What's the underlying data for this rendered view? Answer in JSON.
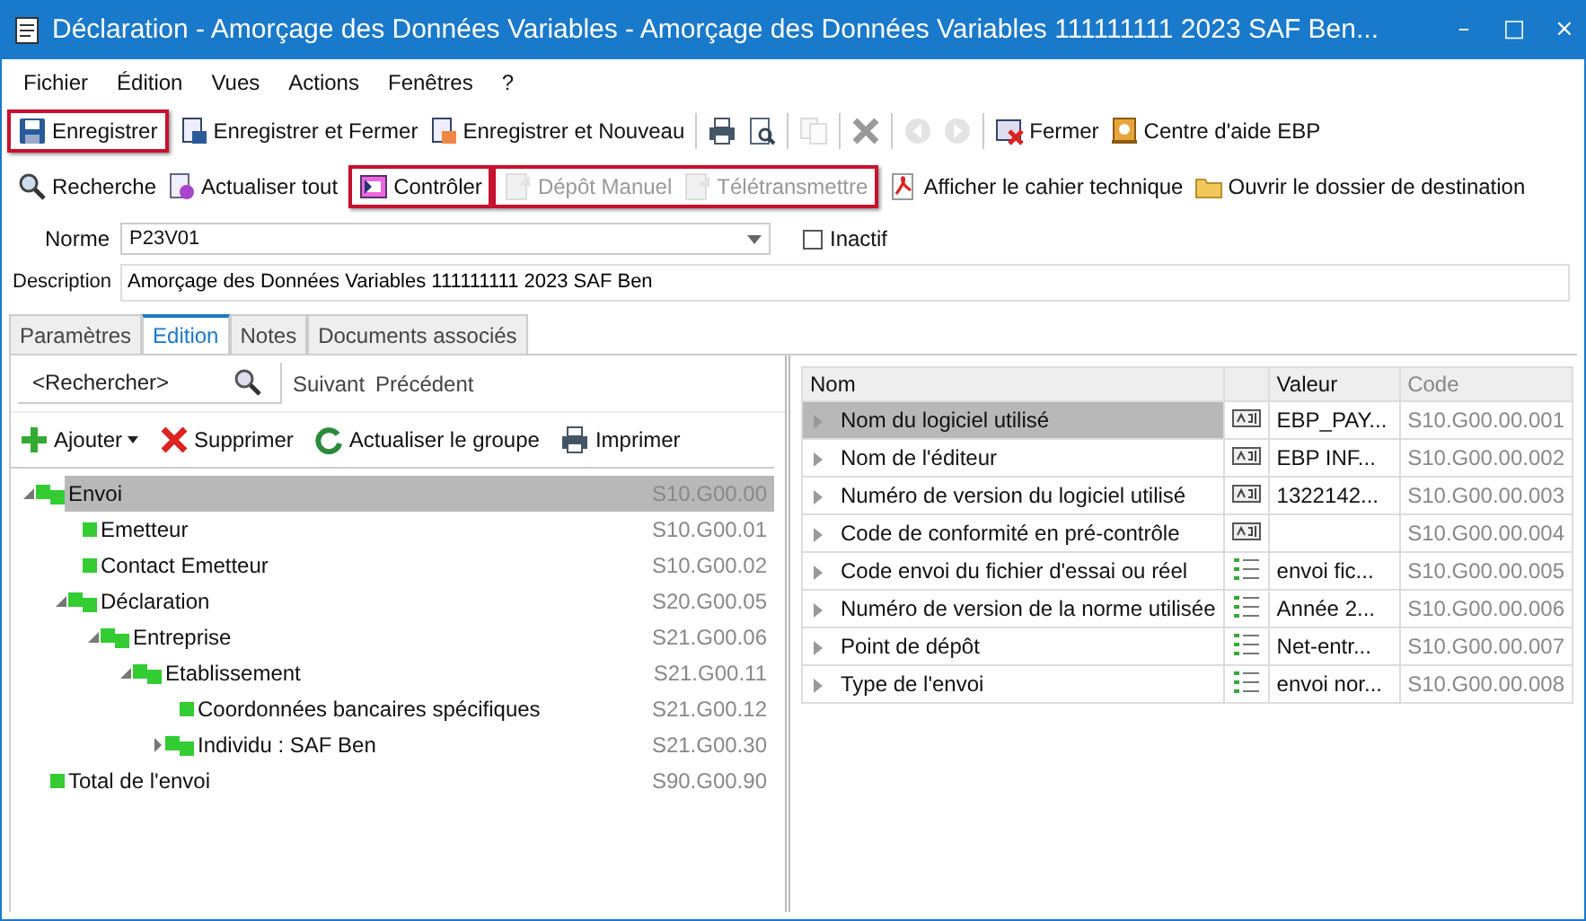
{
  "window": {
    "title": "Déclaration - Amorçage des Données Variables - Amorçage des Données Variables 111111111 2023 SAF Ben...",
    "controls": [
      "–",
      "□",
      "×"
    ]
  },
  "menu": [
    "Fichier",
    "Édition",
    "Vues",
    "Actions",
    "Fenêtres",
    "?"
  ],
  "toolbar_1": [
    {
      "highlighted": true,
      "items": [
        {
          "label": "Enregistrer",
          "disabled": false
        }
      ]
    },
    {
      "highlighted": false,
      "items": [
        {
          "label": "Enregistrer et Fermer",
          "disabled": false
        },
        {
          "label": "Enregistrer et Nouveau",
          "disabled": false
        },
        {
          "disabled": false
        },
        {
          "disabled": false
        },
        {
          "disabled": true
        },
        {
          "disabled": false
        },
        {
          "disabled": true
        },
        {
          "disabled": true
        },
        {
          "label": "Fermer",
          "disabled": false
        },
        {
          "label": "Centre d'aide EBP",
          "disabled": false
        }
      ]
    }
  ],
  "toolbar_2": [
    {
      "highlighted": false,
      "items": [
        {
          "label": "Recherche",
          "disabled": false
        },
        {
          "label": "Actualiser tout",
          "disabled": false
        }
      ]
    },
    {
      "highlighted": true,
      "items": [
        {
          "label": "Contrôler",
          "disabled": false
        }
      ]
    },
    {
      "highlighted": true,
      "items": [
        {
          "label": "Dépôt Manuel",
          "disabled": true
        },
        {
          "label": "Télétransmettre",
          "disabled": true
        }
      ]
    },
    {
      "highlighted": false,
      "items": [
        {
          "label": "Afficher le cahier technique",
          "disabled": false
        },
        {
          "label": "Ouvrir le dossier de destination",
          "disabled": false
        }
      ]
    }
  ],
  "form": {
    "norme": {
      "label": "Norme",
      "value": "P23V01"
    },
    "inactif": {
      "label": "Inactif",
      "checked": false
    },
    "description": {
      "label": "Description",
      "value": "Amorçage des Données Variables 111111111 2023 SAF Ben"
    }
  },
  "tabs": [
    {
      "label": "Paramètres",
      "selected": false
    },
    {
      "label": "Edition",
      "selected": true
    },
    {
      "label": "Notes",
      "selected": false
    },
    {
      "label": "Documents associés",
      "selected": false
    }
  ],
  "search": {
    "placeholder": "<Rechercher>",
    "next": "Suivant",
    "previous": "Précédent"
  },
  "edit_toolbar": [
    {
      "label": "Ajouter",
      "dropdown": true
    },
    {
      "label": "Supprimer",
      "dropdown": false
    },
    {
      "label": "Actualiser le groupe",
      "dropdown": false
    },
    {
      "label": "Imprimer",
      "dropdown": false
    }
  ],
  "tree": [
    {
      "label": "Envoi",
      "code": "S10.G00.00",
      "selected": true,
      "expanded": true,
      "children": [
        {
          "label": "Emetteur",
          "code": "S10.G00.01",
          "selected": false
        },
        {
          "label": "Contact Emetteur",
          "code": "S10.G00.02",
          "selected": false
        },
        {
          "label": "Déclaration",
          "code": "S20.G00.05",
          "selected": false,
          "expanded": true,
          "children": [
            {
              "label": "Entreprise",
              "code": "S21.G00.06",
              "selected": false,
              "expanded": true,
              "children": [
                {
                  "label": "Etablissement",
                  "code": "S21.G00.11",
                  "selected": false,
                  "expanded": true,
                  "children": [
                    {
                      "label": "Coordonnées bancaires spécifiques",
                      "code": "S21.G00.12",
                      "selected": false
                    },
                    {
                      "label": "Individu : SAF Ben",
                      "code": "S21.G00.30",
                      "selected": false,
                      "expanded": false
                    }
                  ]
                }
              ]
            }
          ]
        }
      ]
    },
    {
      "label": "Total de l'envoi",
      "code": "S90.G00.90",
      "selected": false
    }
  ],
  "grid": {
    "columns": [
      "Nom",
      "Valeur",
      "Code"
    ],
    "rows": [
      {
        "name": "Nom du logiciel utilisé",
        "kind": "text",
        "value": "EBP_PAY...",
        "code": "S10.G00.00.001",
        "selected": true
      },
      {
        "name": "Nom de l'éditeur",
        "kind": "text",
        "value": "EBP INF...",
        "code": "S10.G00.00.002",
        "selected": false
      },
      {
        "name": "Numéro de version du logiciel utilisé",
        "kind": "text",
        "value": "1322142...",
        "code": "S10.G00.00.003",
        "selected": false
      },
      {
        "name": "Code de conformité en pré-contrôle",
        "kind": "text",
        "code": "S10.G00.00.004",
        "selected": false
      },
      {
        "name": "Code envoi du fichier d'essai ou réel",
        "kind": "list",
        "value": "envoi fic...",
        "code": "S10.G00.00.005",
        "selected": false
      },
      {
        "name": "Numéro de version de la norme utilisée",
        "kind": "list",
        "value": "Année 2...",
        "code": "S10.G00.00.006",
        "selected": false
      },
      {
        "name": "Point de dépôt",
        "kind": "list",
        "value": "Net-entr...",
        "code": "S10.G00.00.007",
        "selected": false
      },
      {
        "name": "Type de l'envoi",
        "kind": "list",
        "value": "envoi nor...",
        "code": "S10.G00.00.008",
        "selected": false
      }
    ]
  }
}
